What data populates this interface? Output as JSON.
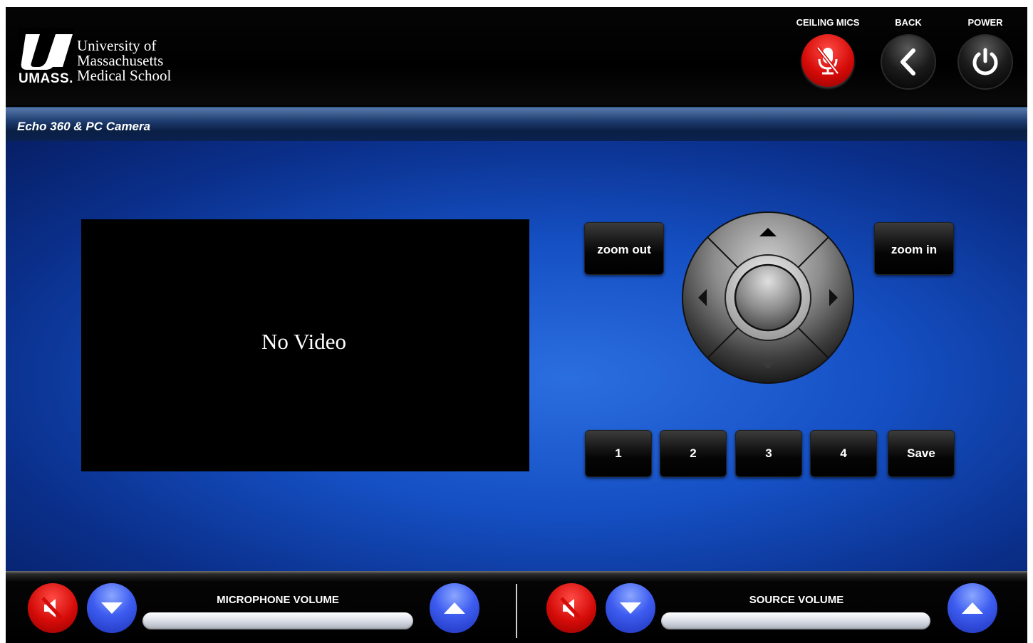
{
  "header": {
    "logo": {
      "line1": "University of",
      "line2": "Massachusetts",
      "line3": "Medical School",
      "umass": "UMASS."
    },
    "buttons": [
      {
        "label": "CEILING MICS",
        "icon": "mic-muted-icon"
      },
      {
        "label": "BACK",
        "icon": "chevron-left-icon"
      },
      {
        "label": "POWER",
        "icon": "power-icon"
      }
    ]
  },
  "title": "Echo 360 & PC Camera",
  "video": {
    "placeholder": "No Video"
  },
  "camera": {
    "zoom_out_label": "zoom out",
    "zoom_in_label": "zoom in",
    "presets": [
      "1",
      "2",
      "3",
      "4"
    ],
    "save_label": "Save"
  },
  "footer": {
    "mic": {
      "label": "MICROPHONE VOLUME"
    },
    "source": {
      "label": "SOURCE VOLUME"
    }
  },
  "colors": {
    "mute_red": "#d40b08",
    "volume_blue": "#3d5cf0",
    "background_blue": "#1550c4"
  }
}
